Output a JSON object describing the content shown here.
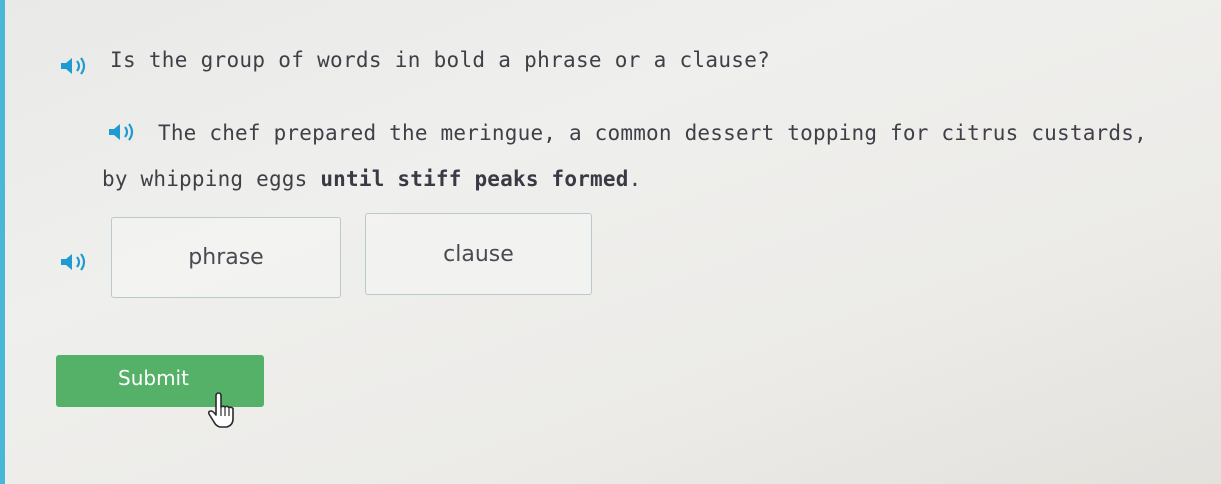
{
  "question": {
    "text": "Is the group of words in bold a phrase or a clause?",
    "audio_icon": "speaker-icon"
  },
  "sentence": {
    "before_bold": "The chef prepared the meringue, a common dessert topping for citrus custards, by whipping eggs ",
    "bold": "until stiff peaks formed",
    "after_bold": ".",
    "audio_icon": "speaker-icon"
  },
  "choices": {
    "audio_icon": "speaker-icon",
    "options": [
      {
        "label": "phrase"
      },
      {
        "label": "clause"
      }
    ]
  },
  "submit": {
    "label": "Submit",
    "color": "#55b068"
  },
  "colors": {
    "accent_rule": "#49b8d8",
    "speaker": "#1f9bd1"
  },
  "cursor_icon": "pointer-hand-icon"
}
